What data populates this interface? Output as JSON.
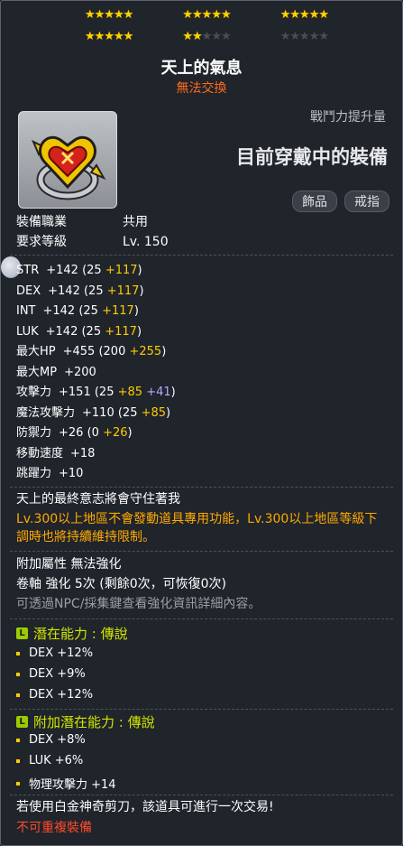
{
  "stars": {
    "row1": [
      [
        true,
        true,
        true,
        true,
        true
      ],
      [
        true,
        true,
        true,
        true,
        true
      ],
      [
        true,
        true,
        true,
        true,
        true
      ]
    ],
    "row2": [
      [
        true,
        true,
        true,
        true,
        true
      ],
      [
        true,
        true,
        false,
        false,
        false
      ],
      [
        false,
        false,
        false,
        false,
        false
      ]
    ],
    "glyph": "★"
  },
  "item": {
    "name": "天上的氣息",
    "trade_status": "無法交換",
    "icon": "heart-pendant-ring-icon"
  },
  "header_right": {
    "combat_power": "戰鬥力提升量",
    "equipped": "目前穿戴中的裝備",
    "tags": [
      "飾品",
      "戒指"
    ]
  },
  "requirements": [
    {
      "label": "裝備職業",
      "value": "共用"
    },
    {
      "label": "要求等級",
      "value": "Lv. 150"
    }
  ],
  "stats": [
    {
      "name": "STR",
      "total": "+142",
      "parts": [
        {
          "t": "(25 ",
          "c": "w"
        },
        {
          "t": "+117",
          "c": "y"
        },
        {
          "t": ")",
          "c": "w"
        }
      ]
    },
    {
      "name": "DEX",
      "total": "+142",
      "parts": [
        {
          "t": "(25 ",
          "c": "w"
        },
        {
          "t": "+117",
          "c": "y"
        },
        {
          "t": ")",
          "c": "w"
        }
      ]
    },
    {
      "name": "INT",
      "total": "+142",
      "parts": [
        {
          "t": "(25 ",
          "c": "w"
        },
        {
          "t": "+117",
          "c": "y"
        },
        {
          "t": ")",
          "c": "w"
        }
      ]
    },
    {
      "name": "LUK",
      "total": "+142",
      "parts": [
        {
          "t": "(25 ",
          "c": "w"
        },
        {
          "t": "+117",
          "c": "y"
        },
        {
          "t": ")",
          "c": "w"
        }
      ]
    },
    {
      "name": "最大HP",
      "total": "+455",
      "parts": [
        {
          "t": "(200 ",
          "c": "w"
        },
        {
          "t": "+255",
          "c": "y"
        },
        {
          "t": ")",
          "c": "w"
        }
      ]
    },
    {
      "name": "最大MP",
      "total": "+200",
      "parts": []
    },
    {
      "name": "攻擊力",
      "total": "+151",
      "parts": [
        {
          "t": "(25 ",
          "c": "w"
        },
        {
          "t": "+85",
          "c": "y"
        },
        {
          "t": " ",
          "c": "w"
        },
        {
          "t": "+41",
          "c": "p"
        },
        {
          "t": ")",
          "c": "w"
        }
      ]
    },
    {
      "name": "魔法攻擊力",
      "total": "+110",
      "parts": [
        {
          "t": "(25 ",
          "c": "w"
        },
        {
          "t": "+85",
          "c": "y"
        },
        {
          "t": ")",
          "c": "w"
        }
      ]
    },
    {
      "name": "防禦力",
      "total": "+26",
      "parts": [
        {
          "t": "(0 ",
          "c": "w"
        },
        {
          "t": "+26",
          "c": "y"
        },
        {
          "t": ")",
          "c": "w"
        }
      ]
    },
    {
      "name": "移動速度",
      "total": "+18",
      "parts": []
    },
    {
      "name": "跳躍力",
      "total": "+10",
      "parts": []
    }
  ],
  "description": {
    "flavor": "天上的最終意志將會守住著我",
    "restriction": "Lv.300以上地區不會發動道具專用功能，Lv.300以上地區等級下調時也將持續維持限制。"
  },
  "enhance": {
    "line1": "附加屬性 無法強化",
    "line2": "卷軸 強化 5次 (剩餘0次，可恢復0次)",
    "line3": "可透過NPC/採集鍵查看強化資訊詳細內容。"
  },
  "potential": {
    "badge": "L",
    "title": "潛在能力 : 傳說",
    "lines": [
      "DEX +12%",
      "DEX +9%",
      "DEX +12%"
    ]
  },
  "bonus_potential": {
    "badge": "L",
    "title": "附加潛在能力 : 傳說",
    "lines": [
      "DEX +8%",
      "LUK +6%",
      "物理攻擊力 +14"
    ]
  },
  "footer": {
    "scissors": "若使用白金神奇剪刀，該道具可進行一次交易!",
    "unique": "不可重複裝備"
  },
  "colors": {
    "star_on": "#ffd200",
    "star_off": "#4a4d55",
    "bonus_yellow": "#ffcc00",
    "bonus_purple": "#b6a9ff",
    "potential_green": "#cfe600",
    "warning_orange": "#ff6a1a",
    "legendary_badge": "#9ccc00"
  }
}
